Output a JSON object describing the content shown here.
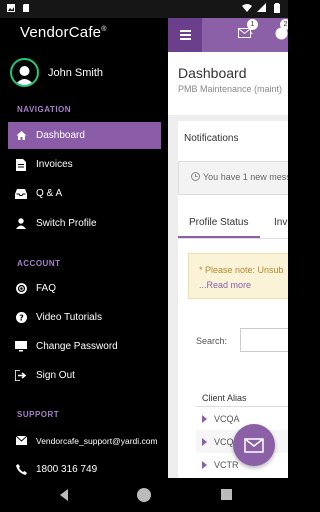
{
  "drawer": {
    "brand": "VendorCafe",
    "brand_mark": "®",
    "user_name": "John Smith",
    "sections": {
      "navigation": "NAVIGATION",
      "account": "ACCOUNT",
      "support": "SUPPORT"
    },
    "nav_items": [
      {
        "label": "Dashboard",
        "icon": "home-icon",
        "active": true
      },
      {
        "label": "Invoices",
        "icon": "document-icon",
        "active": false
      },
      {
        "label": "Q & A",
        "icon": "inbox-icon",
        "active": false
      },
      {
        "label": "Switch Profile",
        "icon": "person-icon",
        "active": false
      }
    ],
    "account_items": [
      {
        "label": "FAQ",
        "icon": "lifebuoy-icon"
      },
      {
        "label": "Video Tutorials",
        "icon": "question-circle-icon"
      },
      {
        "label": "Change Password",
        "icon": "monitor-icon"
      },
      {
        "label": "Sign Out",
        "icon": "sign-out-icon"
      }
    ],
    "support_items": [
      {
        "label": "Vendorcafe_support@yardi.com",
        "icon": "envelope-icon"
      },
      {
        "label": "1800 316 749",
        "icon": "phone-icon"
      }
    ]
  },
  "app": {
    "mail_badge": "1",
    "second_badge": "2",
    "page_title": "Dashboard",
    "page_subtitle": "PMB Maintenance (maint)",
    "notifications_title": "Notifications",
    "notification_text": "You have 1 new mess",
    "tabs": [
      "Profile Status",
      "Inv"
    ],
    "note_text": "* Please note: Unsub",
    "note_link": "...Read more",
    "search_label": "Search:",
    "column_header": "Client Alias",
    "rows": [
      "VCQA",
      "VCQASP",
      "VCTR"
    ]
  },
  "colors": {
    "accent": "#8b60a7",
    "accent_dark": "#6c3f8c",
    "active_item": "#8a5ca8",
    "section_label": "#a67fc9",
    "avatar_ring": "#21c77a"
  }
}
